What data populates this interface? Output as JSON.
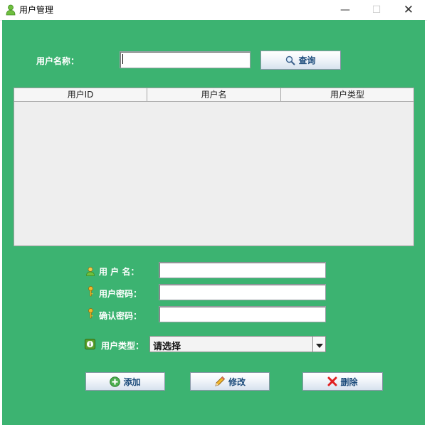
{
  "window": {
    "title": "用户管理",
    "controls": {
      "minimize": "—",
      "maximize": "☐",
      "close": "✕"
    }
  },
  "search": {
    "label": "用户名称：",
    "value": "",
    "button_label": "查询",
    "button_icon": "magnifier-icon"
  },
  "table": {
    "columns": [
      "用户ID",
      "用户名",
      "用户类型"
    ],
    "rows": []
  },
  "form": {
    "username": {
      "label": "用 户 名：",
      "value": "",
      "icon": "user-icon"
    },
    "password": {
      "label": "用户密码：",
      "value": "",
      "icon": "key-icon"
    },
    "confirm_password": {
      "label": "确认密码：",
      "value": "",
      "icon": "key-icon"
    },
    "user_type": {
      "label": "用户类型：",
      "selected": "请选择",
      "icon": "info-icon"
    }
  },
  "actions": {
    "add": {
      "label": "添加",
      "icon": "plus-circle-icon"
    },
    "edit": {
      "label": "修改",
      "icon": "pencil-icon"
    },
    "delete": {
      "label": "删除",
      "icon": "red-x-icon"
    }
  },
  "colors": {
    "content_background": "#3cb371",
    "button_text": "#1a4a7a",
    "label_text": "#ffffff",
    "delete_icon": "#e02020"
  }
}
